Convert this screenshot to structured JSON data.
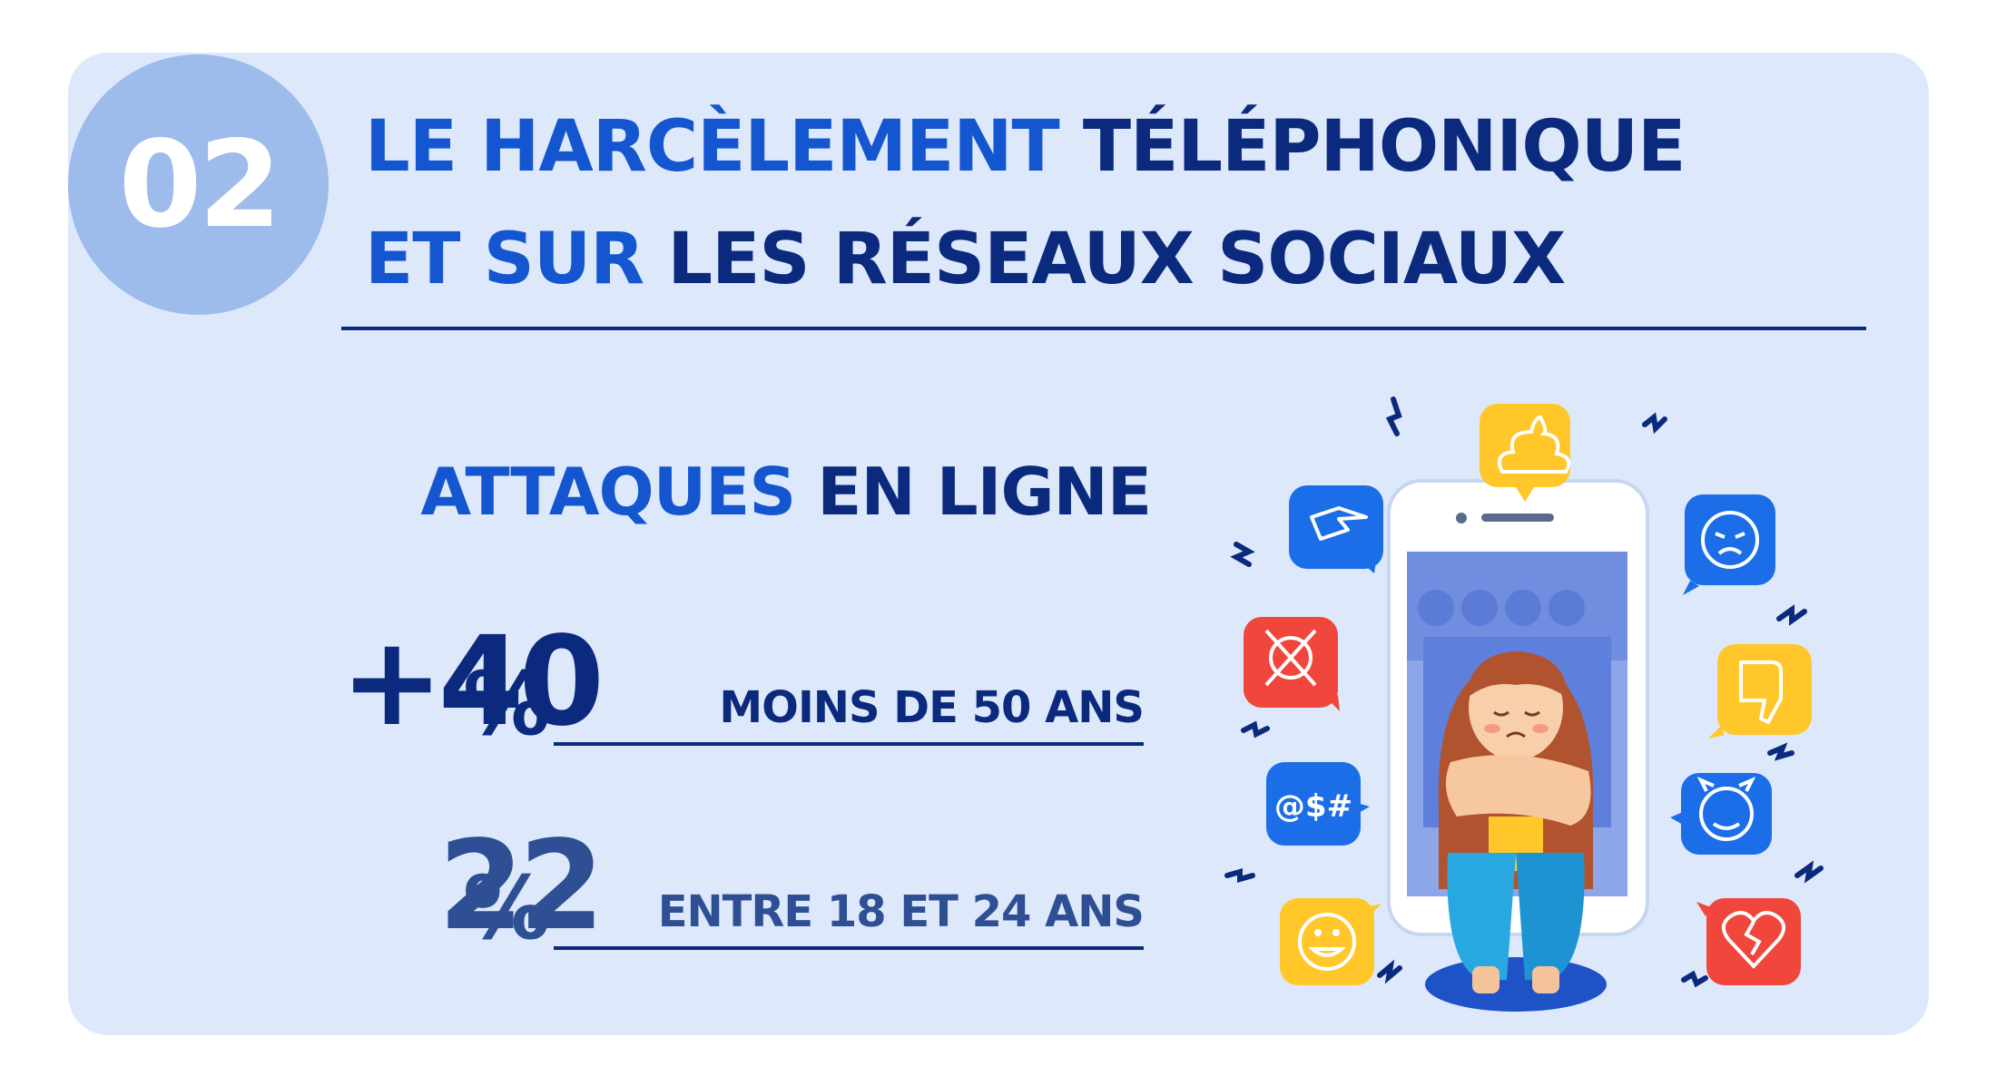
{
  "badge": {
    "number": "02"
  },
  "headline": {
    "line1_light": "LE HARCÈLEMENT ",
    "line1_dark": "TÉLÉPHONIQUE",
    "line2_light": "ET SUR ",
    "line2_dark": "LES RÉSEAUX SOCIAUX"
  },
  "subhead": {
    "light": "ATTAQUES ",
    "dark": "EN LIGNE"
  },
  "stats": [
    {
      "value": "+40",
      "percent_sign": "%",
      "label": "MOINS DE 50 ANS",
      "color": "#0b2a7e"
    },
    {
      "value": "22",
      "percent_sign": "%",
      "label": "ENTRE 18 ET 24 ANS",
      "color": "#2f4f94"
    }
  ],
  "illustration": {
    "icons": [
      "pointing-hand-icon",
      "poop-icon",
      "angry-face-icon",
      "skull-crossbones-icon",
      "thumbs-down-icon",
      "symbols-curse-icon",
      "devil-face-icon",
      "grin-face-icon",
      "broken-heart-icon"
    ],
    "curse_text": "@$#"
  },
  "colors": {
    "card": "#dde9fb",
    "badge_circle": "#9dbceb",
    "accent_light": "#1456cf",
    "accent_dark": "#0b2a7e",
    "bubble_blue": "#1c6ee8",
    "bubble_yellow": "#ffc72a",
    "bubble_red": "#f0463c"
  }
}
